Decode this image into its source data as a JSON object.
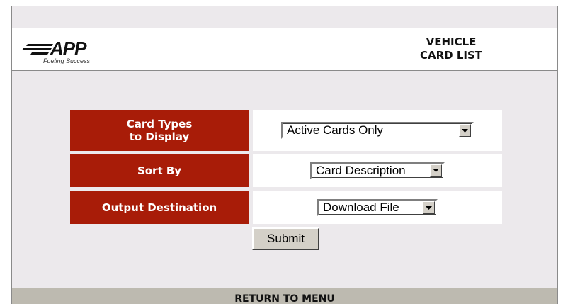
{
  "brand": {
    "logo_text": "APP",
    "tagline": "Fueling Success"
  },
  "page": {
    "title_line1": "VEHICLE",
    "title_line2": "CARD LIST"
  },
  "form": {
    "card_types": {
      "label_line1": "Card Types",
      "label_line2": "to Display",
      "selected": "Active Cards Only"
    },
    "sort_by": {
      "label": "Sort By",
      "selected": "Card Description"
    },
    "output_destination": {
      "label": "Output Destination",
      "selected": "Download File"
    },
    "submit_label": "Submit"
  },
  "footer": {
    "return_label": "RETURN TO MENU"
  },
  "colors": {
    "label_bg": "#a81c08",
    "page_bg": "#ece9ec",
    "footer_bg": "#bdbab0"
  }
}
